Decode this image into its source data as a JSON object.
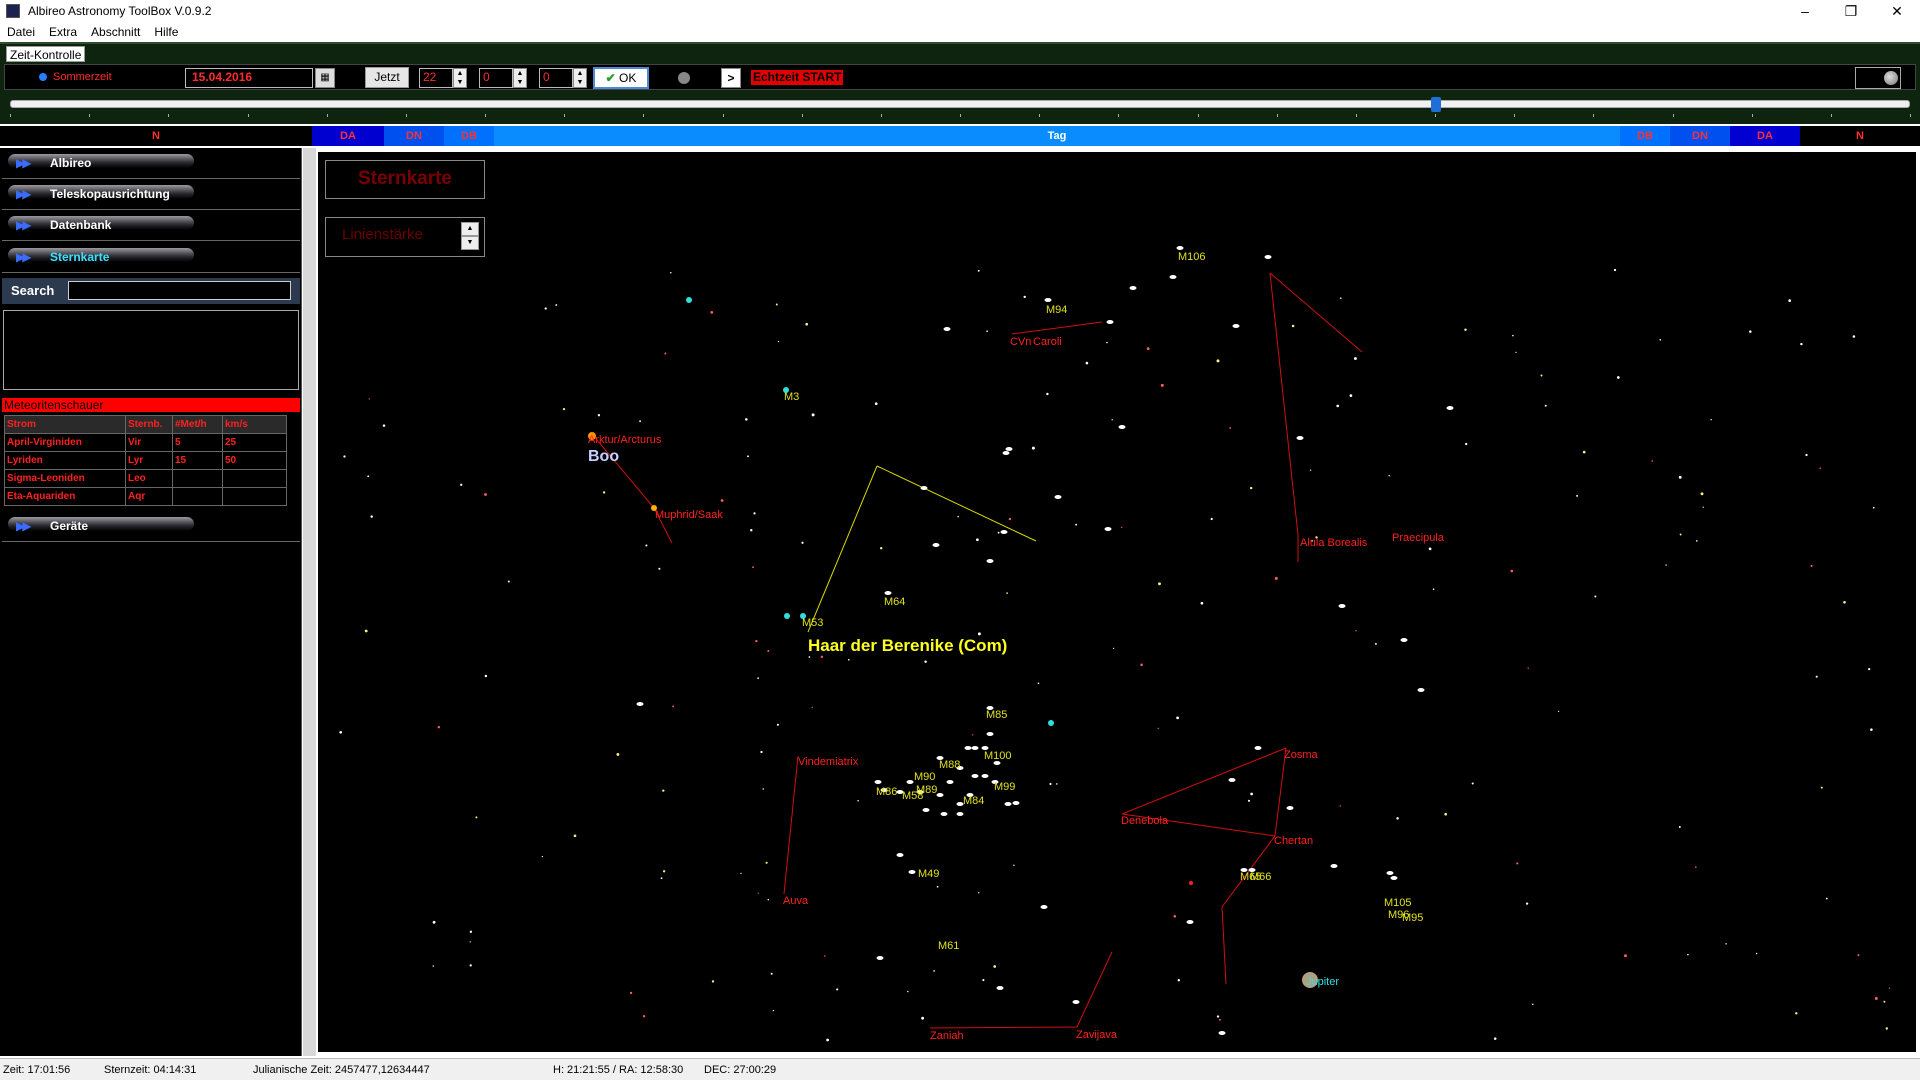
{
  "window": {
    "title": "Albireo Astronomy ToolBox V.0.9.2",
    "controls": [
      "–",
      "❐",
      "✕"
    ]
  },
  "menu": [
    "Datei",
    "Extra",
    "Abschnitt",
    "Hilfe"
  ],
  "time_control": {
    "tab_label": "Zeit-Kontrolle",
    "daylight_label": "Sommerzeit",
    "date": "15.04.2016",
    "now_button": "Jetzt",
    "hour": "22",
    "minute": "0",
    "second": "0",
    "ok_button": "OK",
    "play_button": ">",
    "realtime_button": "Echtzeit START",
    "slider_position": 0.75
  },
  "day_phases": [
    {
      "label": "N",
      "color": "#000000",
      "text": "#ff3030"
    },
    {
      "label": "DA",
      "color": "#0000d0",
      "text": "#ff3030"
    },
    {
      "label": "DN",
      "color": "#0050f0",
      "text": "#ff3030"
    },
    {
      "label": "DB",
      "color": "#0070ff",
      "text": "#ff3030"
    },
    {
      "label": "Tag",
      "color": "#0a8cff",
      "text": "#ffffff"
    },
    {
      "label": "DB",
      "color": "#0070ff",
      "text": "#ff3030"
    },
    {
      "label": "DN",
      "color": "#0050f0",
      "text": "#ff3030"
    },
    {
      "label": "DA",
      "color": "#0000d0",
      "text": "#ff3030"
    },
    {
      "label": "N",
      "color": "#000000",
      "text": "#ff3030"
    }
  ],
  "sidebar": {
    "items": [
      {
        "label": "Albireo",
        "active": false
      },
      {
        "label": "Teleskopausrichtung",
        "active": false
      },
      {
        "label": "Datenbank",
        "active": false
      },
      {
        "label": "Sternkarte",
        "active": true
      }
    ],
    "search_label": "Search",
    "grip": "........",
    "meteor_header": "Meteoritenschauer",
    "meteor_columns": [
      "Strom",
      "Sternb.",
      "#Met/h",
      "km/s"
    ],
    "meteor_rows": [
      [
        "April-Virginiden",
        "Vir",
        "5",
        "25"
      ],
      [
        "Lyriden",
        "Lyr",
        "15",
        "50"
      ],
      [
        "Sigma-Leoniden",
        "Leo",
        "",
        ""
      ],
      [
        "Eta-Aquariden",
        "Aqr",
        "",
        ""
      ]
    ],
    "devices_label": "Geräte"
  },
  "skymap": {
    "title": "Sternkarte",
    "line_width_label": "Linienstärke",
    "constellations": [
      "Boo",
      "Haar der Berenike (Com)"
    ],
    "stars": [
      "Arktur/Arcturus",
      "Muphrid/Saak",
      "CVn",
      "Caroli",
      "Alula Borealis",
      "Praecipula",
      "Vindemiatrix",
      "Auva",
      "Zosma",
      "Denebola",
      "Chertan",
      "Zaniah",
      "Zavijava"
    ],
    "messier": [
      "M106",
      "M94",
      "M3",
      "M53",
      "M64",
      "M85",
      "M100",
      "M88",
      "M90",
      "M89",
      "M58",
      "M84",
      "M86",
      "M99",
      "M49",
      "M65",
      "M66",
      "M61",
      "M105",
      "M96",
      "M95"
    ],
    "planet": "Jupiter"
  },
  "status": {
    "time": "Zeit: 17:01:56",
    "sidereal": "Sternzeit: 04:14:31",
    "julian": "Julianische Zeit: 2457477,12634447",
    "hour_ra": "H: 21:21:55 / RA: 12:58:30",
    "dec": "DEC: 27:00:29"
  }
}
